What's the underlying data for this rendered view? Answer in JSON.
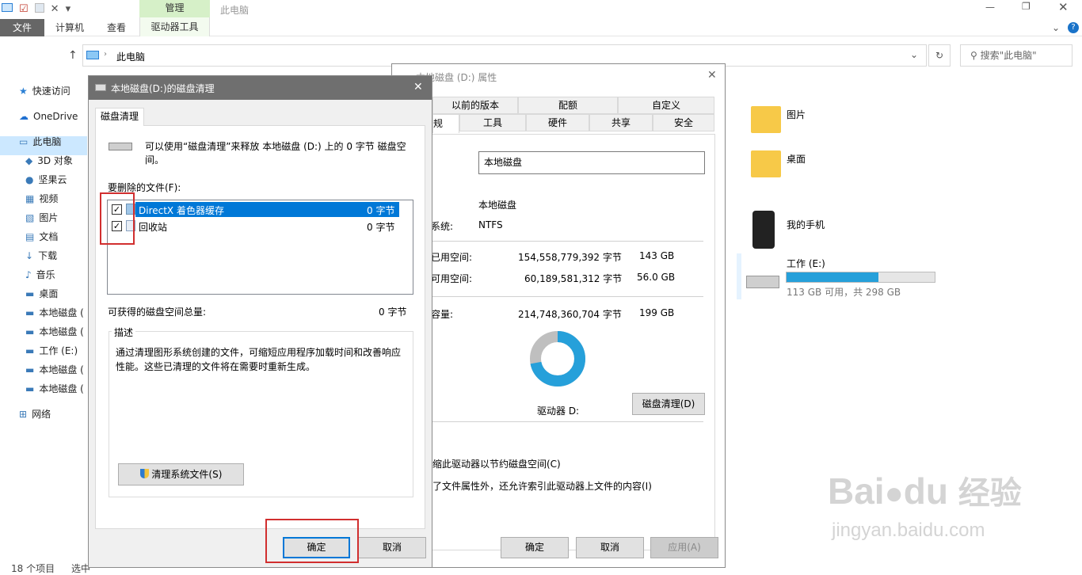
{
  "ribbon": {
    "context_group": "管理",
    "window_title": "此电脑",
    "tabs": [
      "文件",
      "计算机",
      "查看"
    ],
    "context_tab": "驱动器工具"
  },
  "address": {
    "path": "此电脑",
    "search_placeholder": "搜索\"此电脑\""
  },
  "nav": {
    "items": [
      "快速访问",
      "OneDrive",
      "此电脑",
      "3D 对象",
      "坚果云",
      "视频",
      "图片",
      "文档",
      "下载",
      "音乐",
      "桌面",
      "本地磁盘 (",
      "本地磁盘 (",
      "工作 (E:)",
      "本地磁盘 (",
      "本地磁盘 (",
      "网络"
    ]
  },
  "status": {
    "count": "18 个项目",
    "selected": "选中"
  },
  "content": {
    "folders": [
      "图片",
      "桌面"
    ],
    "phone": "我的手机",
    "drive_e_name": "工作 (E:)",
    "drive_e_info": "113 GB 可用，共 298 GB",
    "drive_e_used": 0.62
  },
  "props": {
    "title": "本地磁盘 (D:) 属性",
    "tabs_row1": [
      "以前的版本",
      "配额",
      "自定义"
    ],
    "tabs_row2": [
      "规",
      "工具",
      "硬件",
      "共享",
      "安全"
    ],
    "name_value": "本地磁盘",
    "type_label": "型:",
    "type_value": "本地磁盘",
    "fs_label": "系统:",
    "fs_value": "NTFS",
    "used_label": "已用空间:",
    "used_bytes": "154,558,779,392 字节",
    "used_gb": "143 GB",
    "free_label": "可用空间:",
    "free_bytes": "60,189,581,312 字节",
    "free_gb": "56.0 GB",
    "cap_label": "容量:",
    "cap_bytes": "214,748,360,704 字节",
    "cap_gb": "199 GB",
    "drive_label": "驱动器 D:",
    "cleanup_btn": "磁盘清理(D)",
    "compress": "缩此驱动器以节约磁盘空间(C)",
    "index": "了文件属性外，还允许索引此驱动器上文件的内容(I)",
    "ok": "确定",
    "cancel": "取消",
    "apply": "应用(A)",
    "used_color": "#26a0da",
    "free_color": "#bfbfbf"
  },
  "cleanup": {
    "title": "本地磁盘(D:)的磁盘清理",
    "tab": "磁盘清理",
    "intro": "可以使用“磁盘清理”来释放 本地磁盘 (D:) 上的 0 字节 磁盘空间。",
    "files_label": "要删除的文件(F):",
    "items": [
      {
        "name": "DirectX 着色器缓存",
        "size": "0 字节"
      },
      {
        "name": "回收站",
        "size": "0 字节"
      }
    ],
    "total_label": "可获得的磁盘空间总量:",
    "total_value": "0 字节",
    "desc_label": "描述",
    "desc_text": "通过清理图形系统创建的文件，可缩短应用程序加载时间和改善响应性能。这些已清理的文件将在需要时重新生成。",
    "sys_btn": "清理系统文件(S)",
    "ok": "确定",
    "cancel": "取消"
  },
  "watermark": {
    "brand": "Bai",
    "brand2": "du",
    "cn": "经验",
    "url": "jingyan.baidu.com"
  }
}
